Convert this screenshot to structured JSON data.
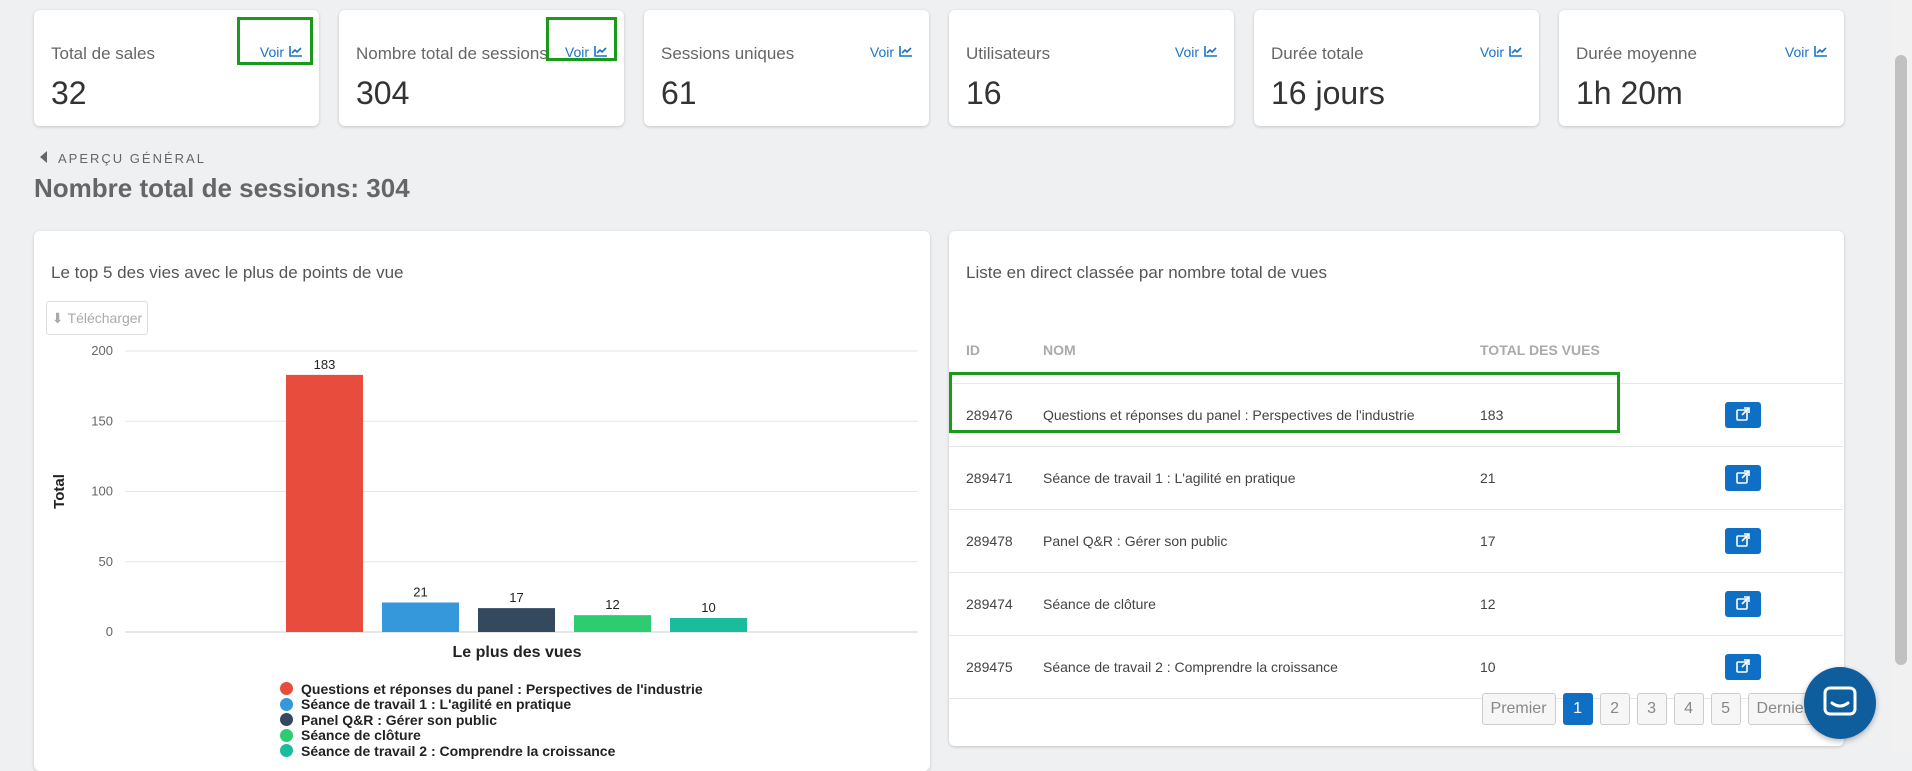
{
  "stats": [
    {
      "label": "Total de sales",
      "value": "32",
      "link": "Voir"
    },
    {
      "label": "Nombre total de sessions",
      "value": "304",
      "link": "Voir"
    },
    {
      "label": "Sessions uniques",
      "value": "61",
      "link": "Voir"
    },
    {
      "label": "Utilisateurs",
      "value": "16",
      "link": "Voir"
    },
    {
      "label": "Durée totale",
      "value": "16 jours",
      "link": "Voir"
    },
    {
      "label": "Durée moyenne",
      "value": "1h 20m",
      "link": "Voir"
    }
  ],
  "back_link": "APERÇU GÉNÉRAL",
  "page_title": "Nombre total de sessions: 304",
  "chart_panel": {
    "title": "Le top 5 des vies avec le plus de points de vue",
    "download_label": "Télécharger"
  },
  "chart_data": {
    "type": "bar",
    "categories": [
      "Questions et réponses du panel : Perspectives de l'industrie",
      "Séance de travail 1 : L'agilité en pratique",
      "Panel Q&R : Gérer son public",
      "Séance de clôture",
      "Séance de travail 2 : Comprendre la croissance"
    ],
    "values": [
      183,
      21,
      17,
      12,
      10
    ],
    "colors": [
      "#e74c3c",
      "#3498db",
      "#34495e",
      "#2ecc71",
      "#1abc9c"
    ],
    "xlabel": "Le plus des vues",
    "ylabel": "Total",
    "ylim": [
      0,
      200
    ],
    "yticks": [
      0,
      50,
      100,
      150,
      200
    ],
    "grid": true,
    "legend": "bottom"
  },
  "list_panel": {
    "title": "Liste en direct classée par nombre total de vues",
    "columns": [
      "ID",
      "NOM",
      "TOTAL DES VUES"
    ],
    "rows": [
      {
        "id": "289476",
        "name": "Questions et réponses du panel : Perspectives de l'industrie",
        "total": "183"
      },
      {
        "id": "289471",
        "name": "Séance de travail 1 : L'agilité en pratique",
        "total": "21"
      },
      {
        "id": "289478",
        "name": "Panel Q&R : Gérer son public",
        "total": "17"
      },
      {
        "id": "289474",
        "name": "Séance de clôture",
        "total": "12"
      },
      {
        "id": "289475",
        "name": "Séance de travail 2 : Comprendre la croissance",
        "total": "10"
      }
    ]
  },
  "pagination": {
    "first": "Premier",
    "pages": [
      "1",
      "2",
      "3",
      "4",
      "5"
    ],
    "active": "1",
    "last": "Dernier"
  },
  "icons": {
    "chart": "line-chart-icon",
    "back": "caret-left-icon",
    "download": "download-icon",
    "external": "external-link-icon",
    "chat": "chat-icon"
  }
}
